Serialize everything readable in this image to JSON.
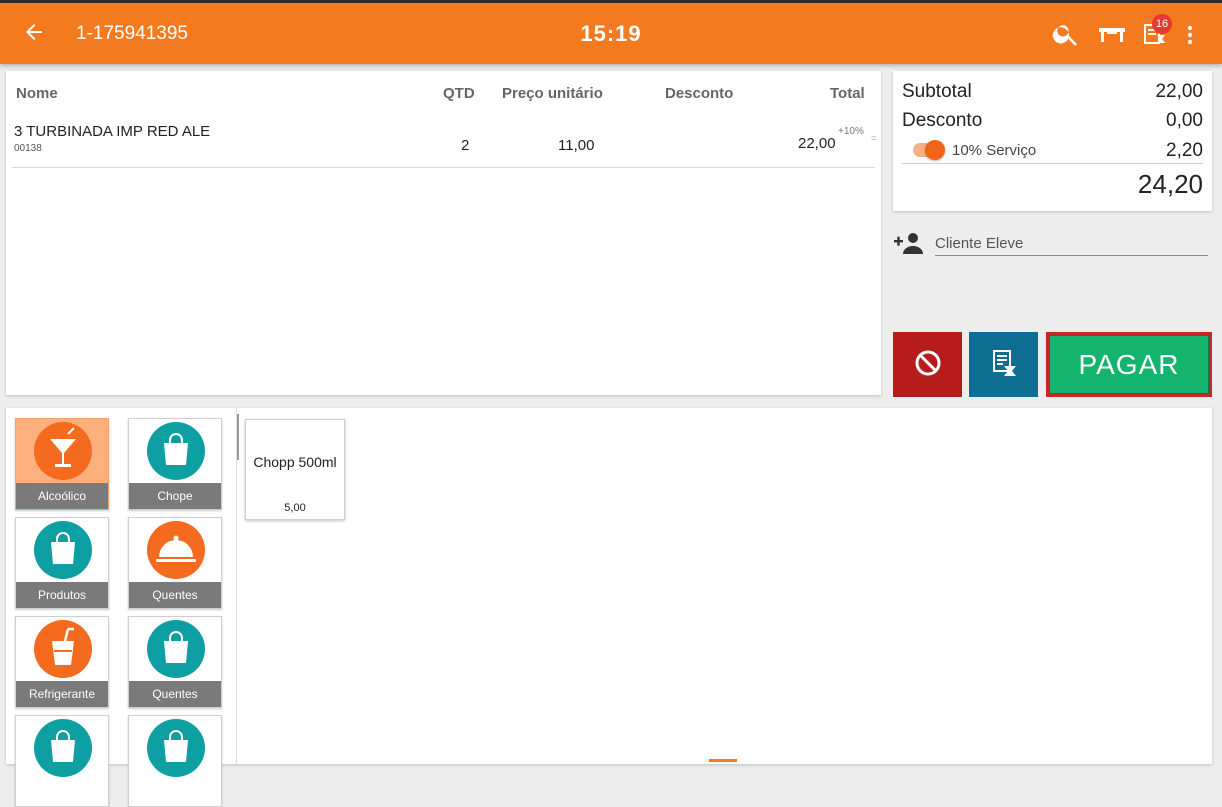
{
  "header": {
    "order_number": "1-175941395",
    "time": "15:19",
    "notification_count": "16"
  },
  "table": {
    "columns": [
      "Nome",
      "QTD",
      "Preço unitário",
      "Desconto",
      "Total"
    ],
    "rows": [
      {
        "name": "3 TURBINADA IMP RED ALE",
        "code": "00138",
        "qty": "2",
        "unit_price": "11,00",
        "discount": "",
        "total": "22,00",
        "service_note": "+10%",
        "marker": "="
      }
    ]
  },
  "summary": {
    "subtotal_label": "Subtotal",
    "subtotal_value": "22,00",
    "discount_label": "Desconto",
    "discount_value": "0,00",
    "service_label": "10% Serviço",
    "service_value": "2,20",
    "service_enabled": true,
    "total_value": "24,20"
  },
  "client": {
    "placeholder": "Cliente Eleve"
  },
  "actions": {
    "pay_label": "PAGAR"
  },
  "categories": [
    {
      "label": "Alcoólico",
      "icon": "cocktail-icon",
      "color": "#f46a1f",
      "selected": true
    },
    {
      "label": "Chope",
      "icon": "shopping-bag-icon",
      "color": "#0e9fa3",
      "selected": false
    },
    {
      "label": "Produtos",
      "icon": "shopping-bag-icon",
      "color": "#0e9fa3",
      "selected": false
    },
    {
      "label": "Quentes",
      "icon": "cloche-icon",
      "color": "#f46a1f",
      "selected": false
    },
    {
      "label": "Refrigerante",
      "icon": "soda-cup-icon",
      "color": "#f46a1f",
      "selected": false
    },
    {
      "label": "Quentes",
      "icon": "shopping-bag-icon",
      "color": "#0e9fa3",
      "selected": false
    },
    {
      "label": "",
      "icon": "shopping-bag-icon",
      "color": "#0e9fa3",
      "selected": false
    },
    {
      "label": "",
      "icon": "shopping-bag-icon",
      "color": "#0e9fa3",
      "selected": false
    }
  ],
  "products": [
    {
      "name": "Chopp 500ml",
      "price": "5,00"
    }
  ],
  "colors": {
    "header": "#f47a20",
    "pay_button": "#14b46e",
    "cancel_button": "#b71c1c",
    "hold_button": "#0d6e91"
  }
}
